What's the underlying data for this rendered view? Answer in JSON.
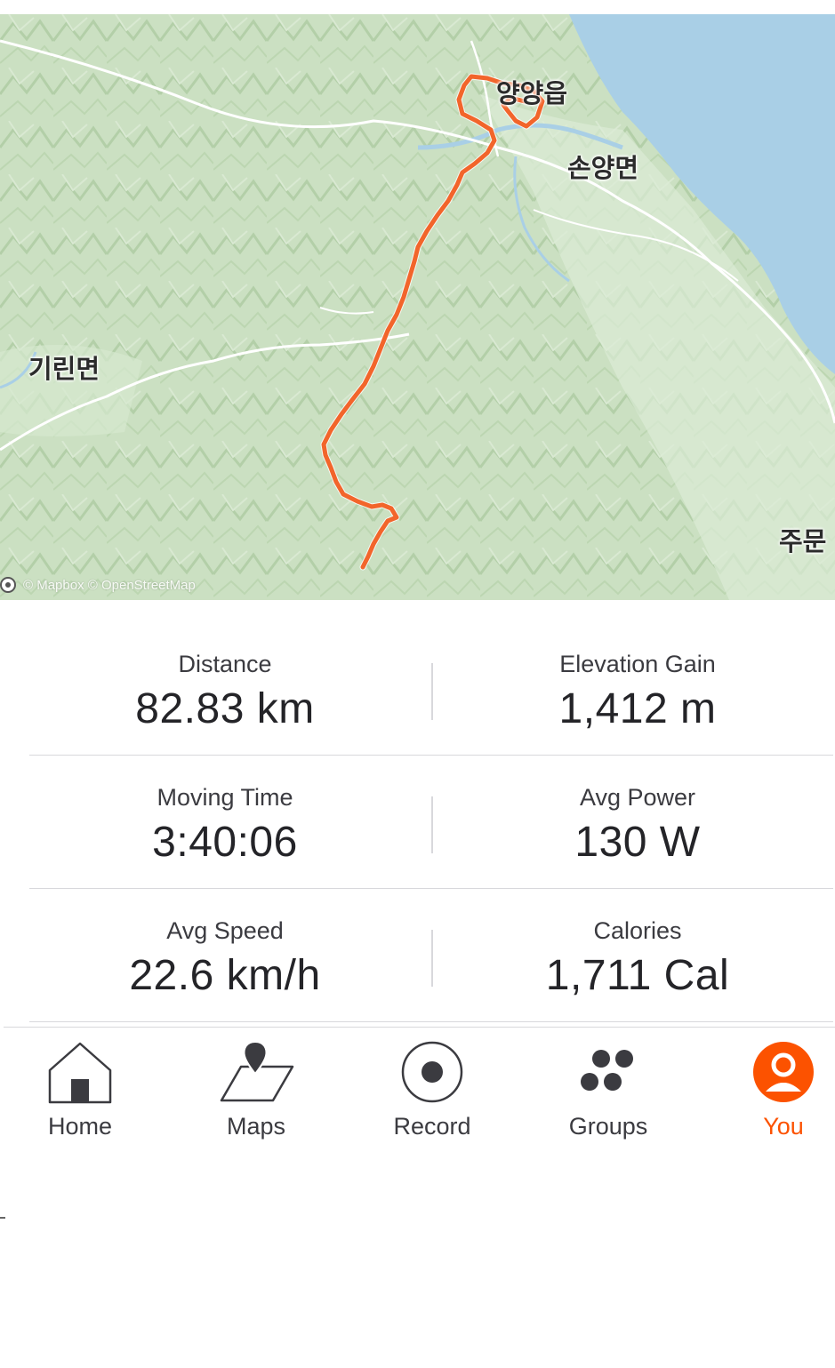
{
  "map": {
    "labels": {
      "yangyang": "양양읍",
      "sonyang": "손양면",
      "girin": "기린면",
      "jumun": "주문"
    },
    "attribution": "© Mapbox © OpenStreetMap",
    "route_color": "#f2652b",
    "water_color": "#a9cfe6",
    "land_color": "#cfe3c7"
  },
  "stats": [
    {
      "label": "Distance",
      "value": "82.83 km"
    },
    {
      "label": "Elevation Gain",
      "value": "1,412 m"
    },
    {
      "label": "Moving Time",
      "value": "3:40:06"
    },
    {
      "label": "Avg Power",
      "value": "130 W"
    },
    {
      "label": "Avg Speed",
      "value": "22.6 km/h"
    },
    {
      "label": "Calories",
      "value": "1,711 Cal"
    }
  ],
  "tabs": [
    {
      "label": "Home",
      "icon": "home-icon"
    },
    {
      "label": "Maps",
      "icon": "maps-icon"
    },
    {
      "label": "Record",
      "icon": "record-icon"
    },
    {
      "label": "Groups",
      "icon": "groups-icon"
    },
    {
      "label": "You",
      "icon": "profile-icon",
      "active": true
    }
  ],
  "accent_color": "#fc5200"
}
